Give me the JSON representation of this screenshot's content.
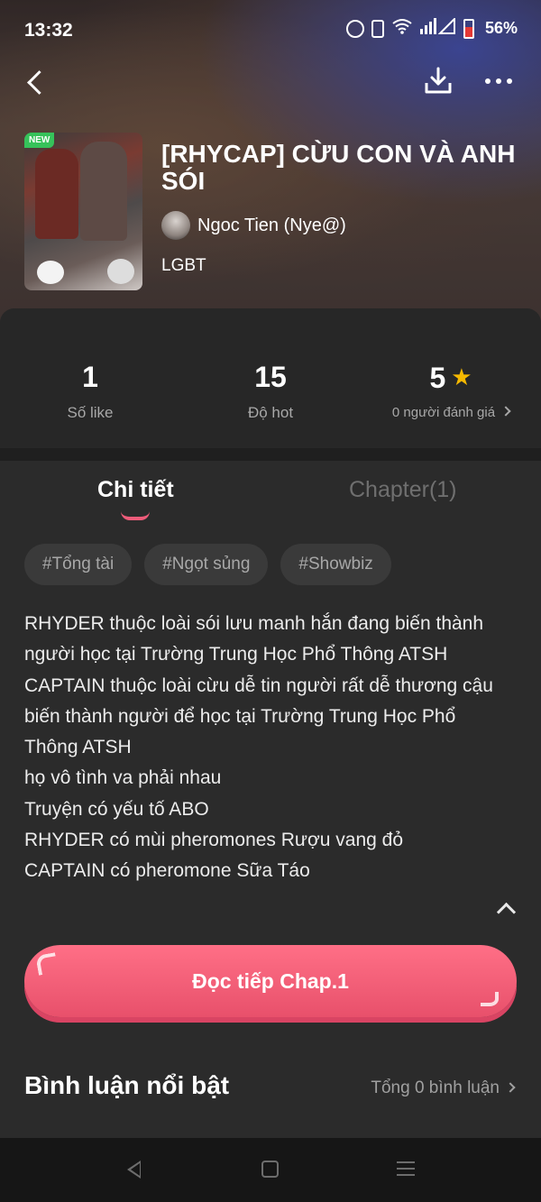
{
  "status_bar": {
    "time": "13:32",
    "battery_percent": "56%",
    "icons": [
      "alarm-icon",
      "vibrate-icon",
      "wifi-icon",
      "signal-icon",
      "battery-icon"
    ]
  },
  "toolbar": {
    "back_icon": "chevron-left-icon",
    "download_icon": "download-icon",
    "more_icon": "more-horizontal-icon"
  },
  "book": {
    "badge": "NEW",
    "title": "[RHYCAP] CỪU CON VÀ ANH SÓI",
    "author": "Ngoc Tien (Nye@)",
    "genre": "LGBT"
  },
  "stats": {
    "likes": {
      "value": "1",
      "label": "Số like"
    },
    "hot": {
      "value": "15",
      "label": "Độ hot"
    },
    "rating": {
      "value": "5",
      "label": "0 người đánh giá"
    }
  },
  "tabs": [
    {
      "label": "Chi tiết",
      "active": true
    },
    {
      "label": "Chapter(1)",
      "active": false
    }
  ],
  "tags": [
    "#Tổng tài",
    "#Ngọt sủng",
    "#Showbiz"
  ],
  "description": [
    "RHYDER thuộc loài sói lưu manh hắn đang biến thành người học tại Trường Trung Học Phổ Thông ATSH",
    "CAPTAIN thuộc loài cừu dễ tin người rất dễ thương cậu biến thành người để học tại Trường Trung Học Phổ Thông ATSH",
    "họ vô tình va phải nhau",
    "Truyện có yếu tố ABO",
    "RHYDER có mùi pheromones Rượu vang đỏ",
    "CAPTAIN có pheromone Sữa Táo"
  ],
  "read_button": {
    "label": "Đọc tiếp Chap.1"
  },
  "comments": {
    "heading": "Bình luận nổi bật",
    "total": "Tổng 0 bình luận"
  },
  "colors": {
    "accent": "#f15d76",
    "star": "#f6b900",
    "background": "#2b2b2b"
  }
}
